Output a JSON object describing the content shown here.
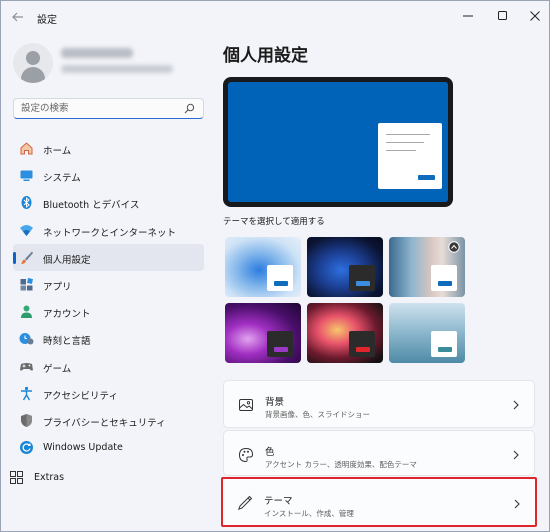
{
  "app": {
    "title": "設定"
  },
  "window_controls": {
    "minimize": "minimize-icon",
    "maximize": "maximize-icon",
    "close": "close-icon"
  },
  "search": {
    "placeholder": "設定の検索"
  },
  "nav": {
    "items": [
      {
        "label": "ホーム",
        "icon": "home-icon",
        "color": "#e0724b"
      },
      {
        "label": "システム",
        "icon": "system-icon",
        "color": "#1a86d8"
      },
      {
        "label": "Bluetooth とデバイス",
        "icon": "bluetooth-icon",
        "color": "#1a86d8"
      },
      {
        "label": "ネットワークとインターネット",
        "icon": "network-icon",
        "color": "#1a86d8"
      },
      {
        "label": "個人用設定",
        "icon": "brush-icon",
        "color": "#e0724b",
        "selected": true
      },
      {
        "label": "アプリ",
        "icon": "apps-icon",
        "color": "#4f5d73"
      },
      {
        "label": "アカウント",
        "icon": "account-icon",
        "color": "#2c9d6d"
      },
      {
        "label": "時刻と言語",
        "icon": "time-language-icon",
        "color": "#1a86d8"
      },
      {
        "label": "ゲーム",
        "icon": "game-icon",
        "color": "#6b6b6b"
      },
      {
        "label": "アクセシビリティ",
        "icon": "accessibility-icon",
        "color": "#1a86d8"
      },
      {
        "label": "プライバシーとセキュリティ",
        "icon": "shield-icon",
        "color": "#6b6b6b"
      },
      {
        "label": "Windows Update",
        "icon": "update-icon",
        "color": "#1a86d8"
      }
    ],
    "extras": {
      "label": "Extras",
      "icon": "extras-icon"
    }
  },
  "main": {
    "title": "個人用設定",
    "themes_label": "テーマを選択して適用する",
    "cards": [
      {
        "title": "背景",
        "subtitle": "背景画像、色、スライドショー",
        "icon": "picture-icon"
      },
      {
        "title": "色",
        "subtitle": "アクセント カラー、透明度効果、配色テーマ",
        "icon": "palette-icon"
      },
      {
        "title": "テーマ",
        "subtitle": "インストール、作成、管理",
        "icon": "pen-icon"
      }
    ]
  },
  "colors": {
    "accent": "#0f62c9",
    "highlight": "#e0262b"
  }
}
